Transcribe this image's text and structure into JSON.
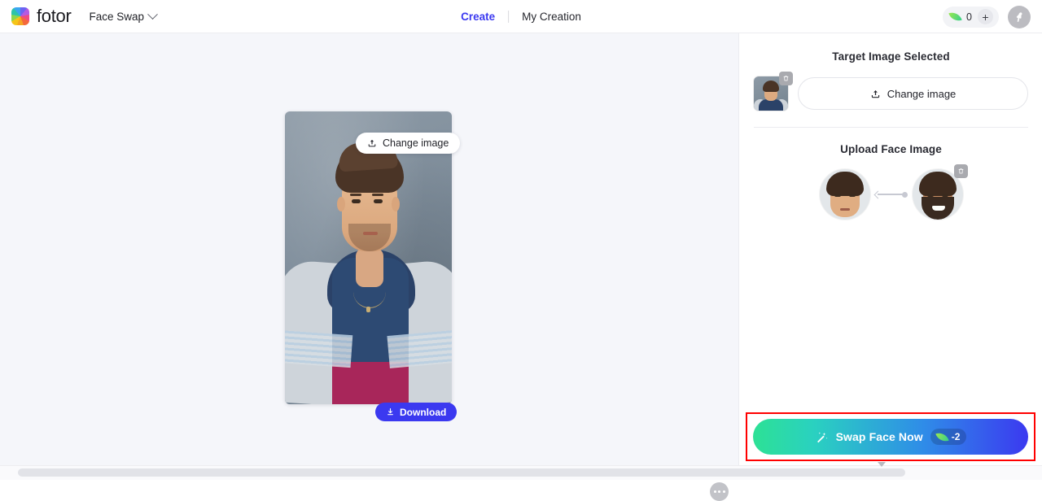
{
  "app": {
    "brand_name": "fotor",
    "logo_icon": "fotor-color-wheel-logo",
    "tool_name": "Face Swap",
    "tool_chevron_icon": "chevron-down-icon"
  },
  "nav": {
    "create_label": "Create",
    "my_creation_label": "My Creation",
    "active": "Create",
    "active_color": "#3b39f0"
  },
  "topbar_right": {
    "credit_icon": "leaf-icon",
    "credit_count": "0",
    "add_credits_label": "+",
    "avatar_icon": "bird-avatar-icon"
  },
  "canvas": {
    "change_image_label": "Change image",
    "change_image_icon": "upload-icon",
    "download_label": "Download",
    "download_icon": "download-icon",
    "more_options_icon": "more-dots-icon",
    "background_color": "#f5f6fa",
    "preview_alt": "Portrait of young man in gray hoodie over navy shirt"
  },
  "panel": {
    "target": {
      "title": "Target Image Selected",
      "thumbnail_alt": "Selected target portrait thumbnail",
      "delete_icon": "trash-icon",
      "change_image_label": "Change image",
      "change_image_icon": "upload-icon"
    },
    "upload_face": {
      "title": "Upload Face Image",
      "connector_icon": "arrow-left-connector-icon",
      "faces": [
        {
          "name": "target-face",
          "alt": "Detected face in target image",
          "delete_icon": null
        },
        {
          "name": "source-face",
          "alt": "Uploaded smiling bearded face",
          "delete_icon": "trash-icon"
        }
      ]
    }
  },
  "swap": {
    "label": "Swap Face Now",
    "wand_icon": "magic-wand-icon",
    "cost_icon": "leaf-icon",
    "cost_value": "-2",
    "gradient_from": "#2de195",
    "gradient_to": "#3b39f0",
    "highlight_color": "#ff0000"
  }
}
